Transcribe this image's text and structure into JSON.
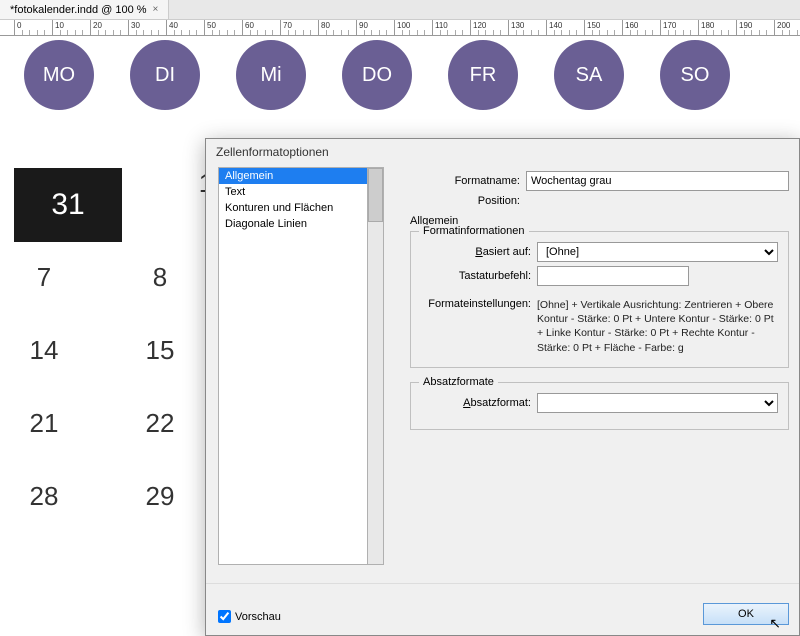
{
  "tab": {
    "title": "*fotokalender.indd @ 100 %",
    "close": "×"
  },
  "ruler": {
    "ticks": [
      0,
      10,
      20,
      30,
      40,
      50,
      60,
      70,
      80,
      90,
      100,
      110,
      120,
      130,
      140,
      150,
      160,
      170,
      180,
      190,
      200
    ]
  },
  "days": [
    "MO",
    "DI",
    "Mi",
    "DO",
    "FR",
    "SA",
    "SO"
  ],
  "calendar": {
    "rows": [
      [
        "31",
        "1"
      ],
      [
        "7",
        "8"
      ],
      [
        "14",
        "15"
      ],
      [
        "21",
        "22"
      ],
      [
        "28",
        "29"
      ]
    ]
  },
  "dialog": {
    "title": "Zellenformatoptionen",
    "categories": [
      "Allgemein",
      "Text",
      "Konturen und Flächen",
      "Diagonale Linien"
    ],
    "selected_cat": 0,
    "labels": {
      "formatname": "Formatname:",
      "position": "Position:",
      "allgemein": "Allgemein",
      "formatinfo": "Formatinformationen",
      "basiert": "Basiert auf:",
      "tastatur": "Tastaturbefehl:",
      "einstellungen": "Formateinstellungen:",
      "absatzformate": "Absatzformate",
      "absatzformat": "Absatzformat:",
      "vorschau": "Vorschau",
      "ok": "OK"
    },
    "values": {
      "formatname": "Wochentag grau",
      "position": "",
      "basiert": "[Ohne]",
      "tastatur": "",
      "einstellungen": "[Ohne] + Vertikale Ausrichtung: Zentrieren + Obere Kontur - Stärke: 0 Pt + Untere Kontur - Stärke: 0 Pt + Linke Kontur - Stärke: 0 Pt + Rechte Kontur - Stärke: 0 Pt + Fläche - Farbe: g",
      "absatzformat": ""
    }
  }
}
